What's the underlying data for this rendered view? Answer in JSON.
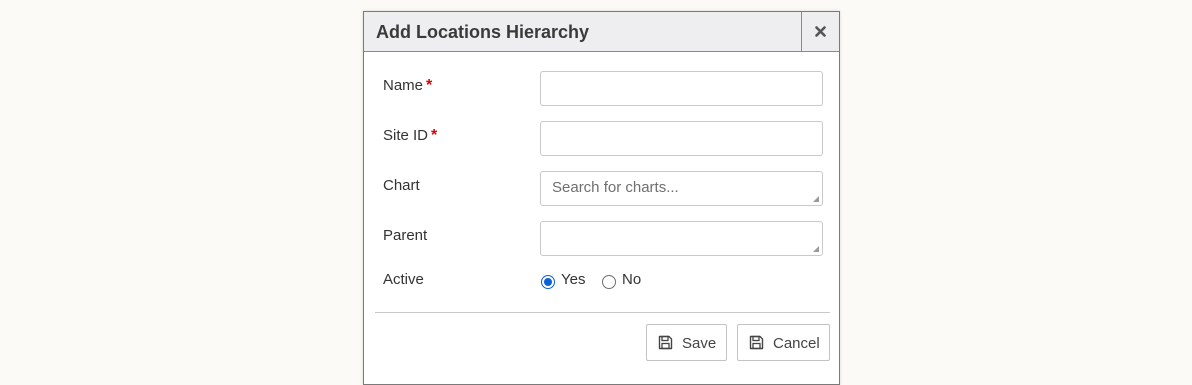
{
  "dialog": {
    "title": "Add Locations Hierarchy",
    "close_icon": "close-icon"
  },
  "form": {
    "name": {
      "label": "Name",
      "required_mark": "*",
      "value": ""
    },
    "site_id": {
      "label": "Site ID",
      "required_mark": "*",
      "value": ""
    },
    "chart": {
      "label": "Chart",
      "placeholder": "Search for charts...",
      "value": ""
    },
    "parent": {
      "label": "Parent",
      "value": ""
    },
    "active": {
      "label": "Active",
      "options": [
        "Yes",
        "No"
      ],
      "selected": "Yes"
    }
  },
  "footer": {
    "save_label": "Save",
    "save_icon": "floppy-disk-icon",
    "cancel_label": "Cancel",
    "cancel_icon": "floppy-disk-icon"
  },
  "colors": {
    "header_bg": "#eeeef0",
    "required": "#e00000",
    "radio_accent": "#0b62d6",
    "page_bg": "#fbfaf6"
  }
}
